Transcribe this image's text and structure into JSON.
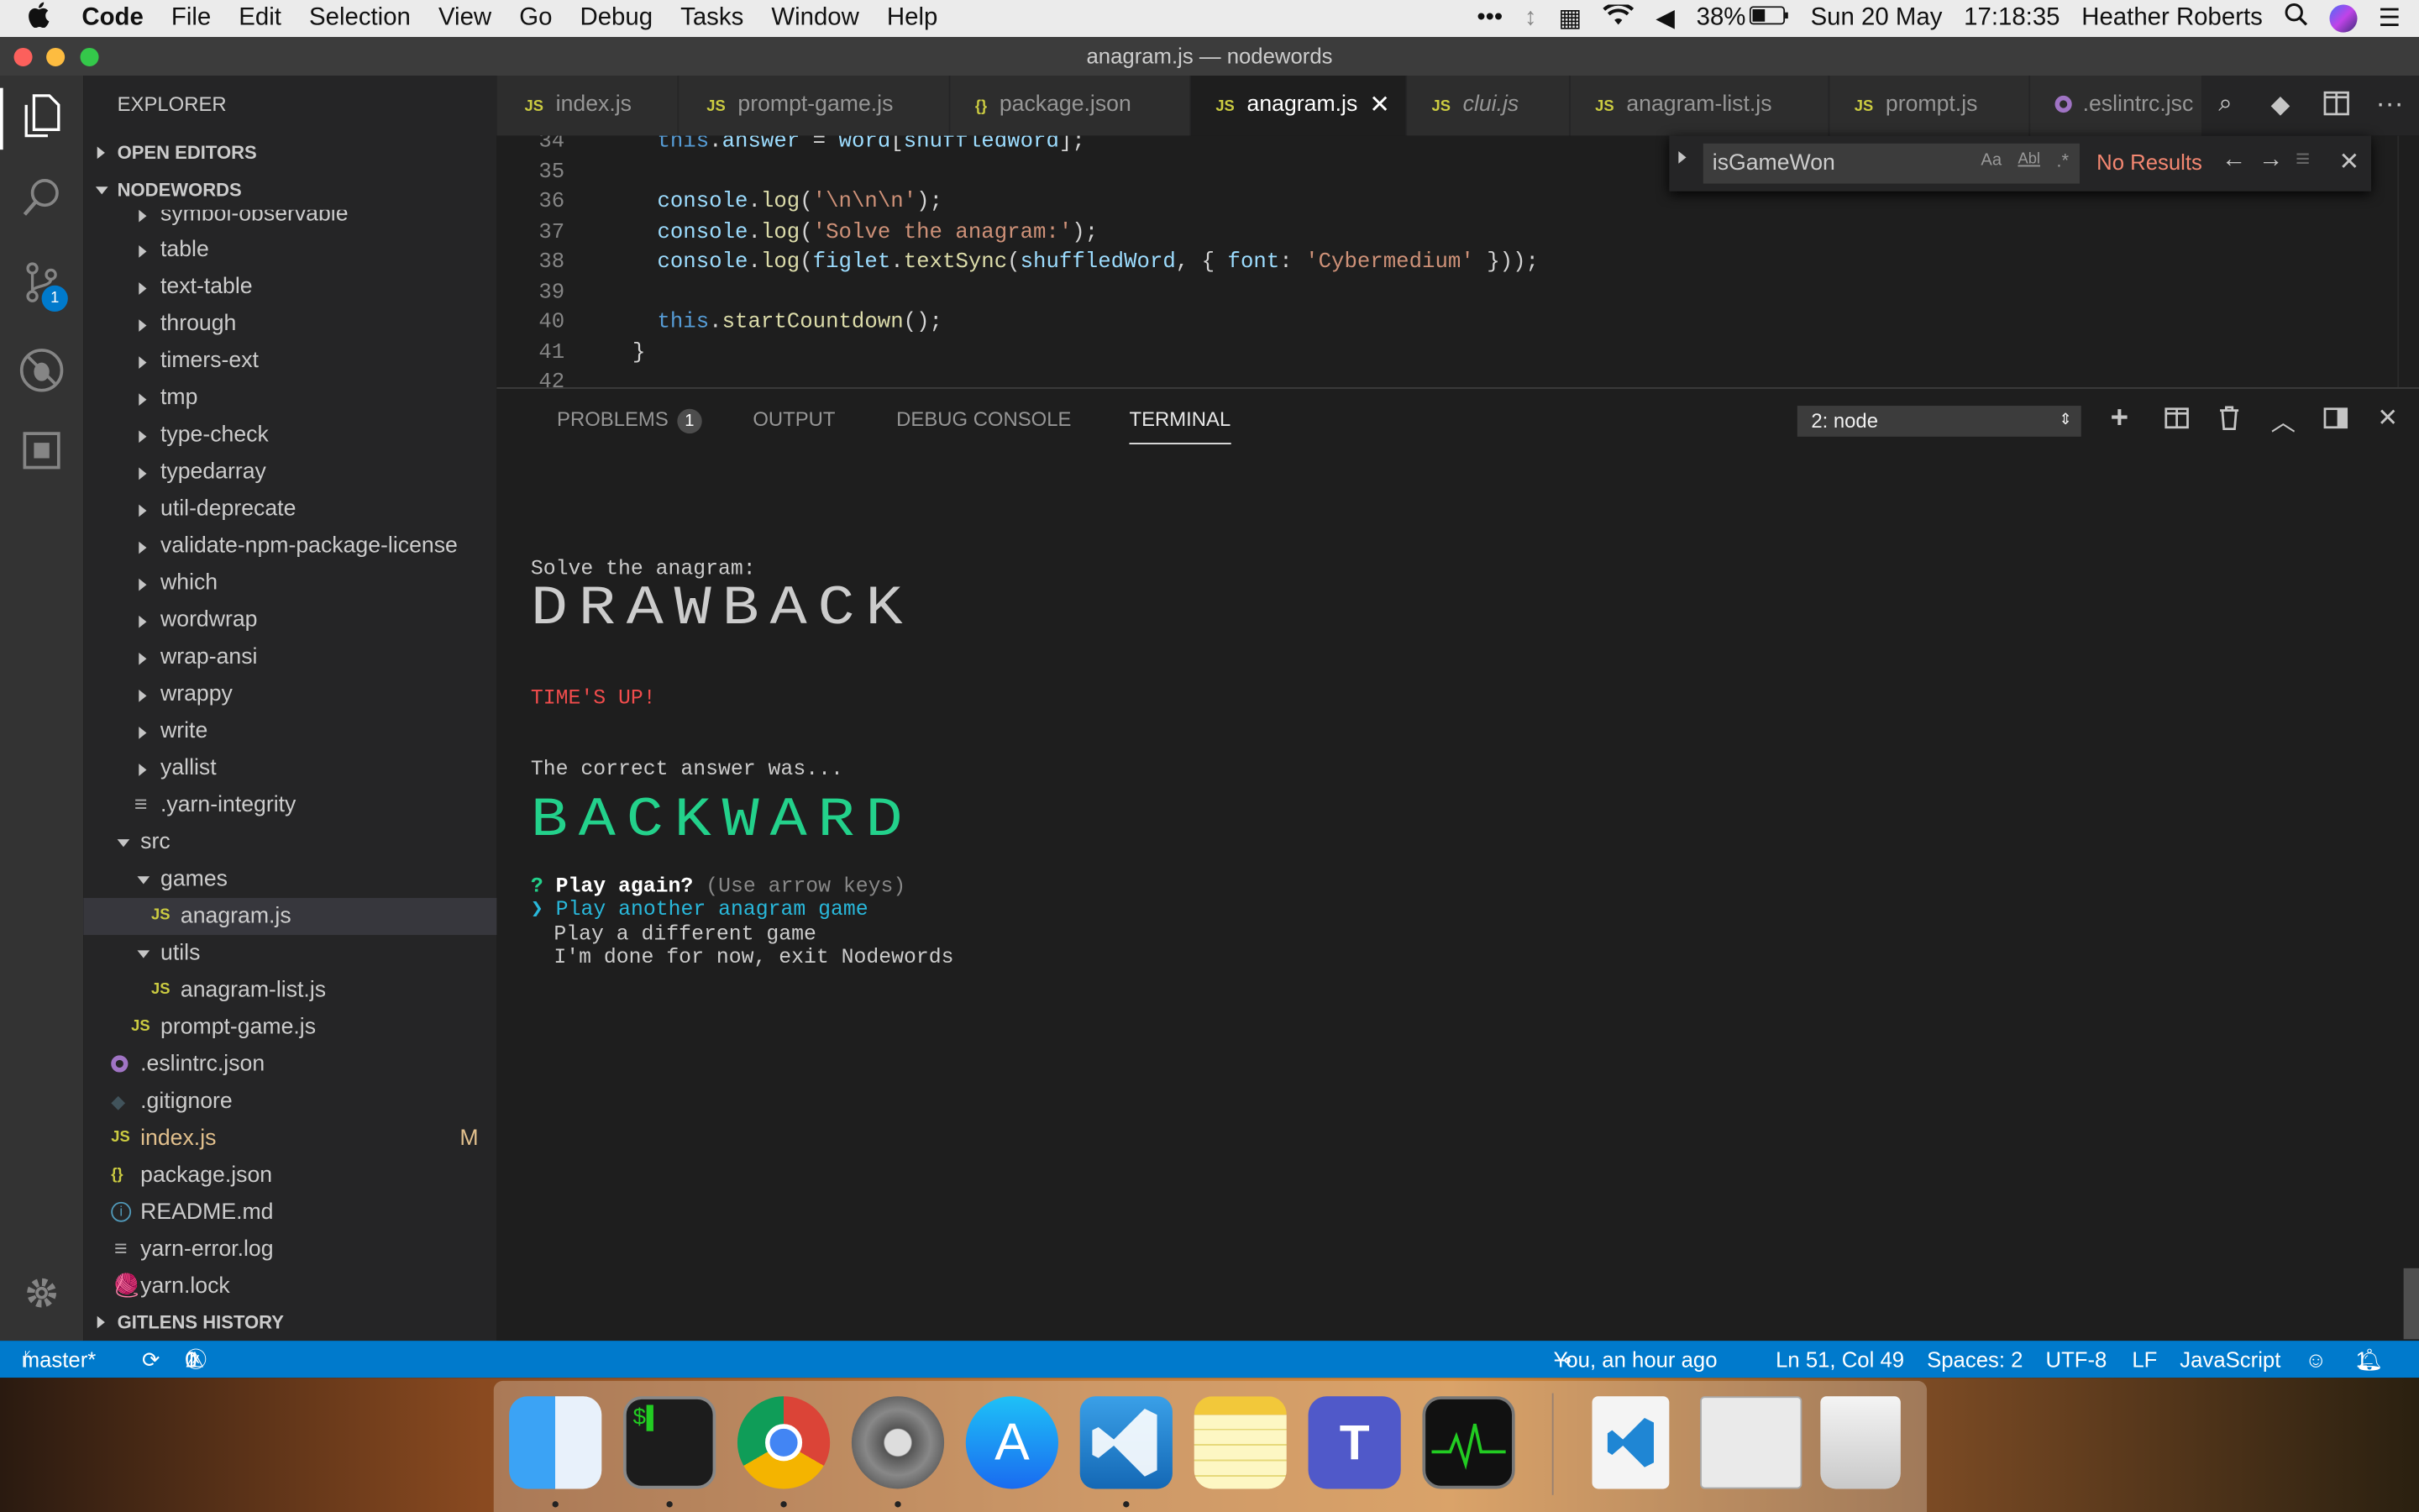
{
  "menubar": {
    "apple": "",
    "app": "Code",
    "items": [
      "File",
      "Edit",
      "Selection",
      "View",
      "Go",
      "Debug",
      "Tasks",
      "Window",
      "Help"
    ],
    "battery": "38%",
    "date": "Sun 20 May",
    "time": "17:18:35",
    "user": "Heather Roberts"
  },
  "window": {
    "title": "anagram.js — nodewords"
  },
  "activity": {
    "scm_badge": "1"
  },
  "sidebar": {
    "header": "EXPLORER",
    "open_editors": "OPEN EDITORS",
    "project": "NODEWORDS",
    "gitlens": "GITLENS HISTORY",
    "items": [
      {
        "label": "symbol-observable"
      },
      {
        "label": "table"
      },
      {
        "label": "text-table"
      },
      {
        "label": "through"
      },
      {
        "label": "timers-ext"
      },
      {
        "label": "tmp"
      },
      {
        "label": "type-check"
      },
      {
        "label": "typedarray"
      },
      {
        "label": "util-deprecate"
      },
      {
        "label": "validate-npm-package-license"
      },
      {
        "label": "which"
      },
      {
        "label": "wordwrap"
      },
      {
        "label": "wrap-ansi"
      },
      {
        "label": "wrappy"
      },
      {
        "label": "write"
      },
      {
        "label": "yallist"
      },
      {
        "label": ".yarn-integrity"
      },
      {
        "label": "src"
      },
      {
        "label": "games"
      },
      {
        "label": "anagram.js"
      },
      {
        "label": "utils"
      },
      {
        "label": "anagram-list.js"
      },
      {
        "label": "prompt-game.js"
      },
      {
        "label": ".eslintrc.json"
      },
      {
        "label": ".gitignore"
      },
      {
        "label": "index.js",
        "badge": "M"
      },
      {
        "label": "package.json"
      },
      {
        "label": "README.md"
      },
      {
        "label": "yarn-error.log"
      },
      {
        "label": "yarn.lock"
      }
    ],
    "js_icon": "JS",
    "json_icon": "{}"
  },
  "tabs": [
    "index.js",
    "prompt-game.js",
    "package.json",
    "anagram.js",
    "clui.js",
    "anagram-list.js",
    "prompt.js",
    ".eslintrc.jsc"
  ],
  "editor": {
    "line_numbers": [
      "34",
      "35",
      "36",
      "37",
      "38",
      "39",
      "40",
      "41",
      "42"
    ]
  },
  "find": {
    "value": "isGameWon",
    "opt_case": "Aa",
    "opt_word": "Abl",
    "opt_regex": ".*",
    "result": "No Results"
  },
  "panel": {
    "problems": "PROBLEMS",
    "problems_count": "1",
    "output": "OUTPUT",
    "debug": "DEBUG CONSOLE",
    "terminal": "TERMINAL",
    "terminal_select": "2: node"
  },
  "terminal": {
    "line1": "Solve the anagram:",
    "big1": "DRAWBACK",
    "timeup": "TIME'S UP!",
    "line2": "The correct answer was...",
    "big2": "BACKWARD",
    "q_mark": "?",
    "question": "Play again?",
    "hint": "(Use arrow keys)",
    "pointer": "❯",
    "opt1": "Play another anagram game",
    "opt2": "Play a different game",
    "opt3": "I'm done for now, exit Nodewords"
  },
  "status": {
    "branch": "master*",
    "errors": "0",
    "warnings": "1",
    "blame": "You, an hour ago",
    "position": "Ln 51, Col 49",
    "spaces": "Spaces: 2",
    "encoding": "UTF-8",
    "eol": "LF",
    "language": "JavaScript",
    "notifications": "1"
  },
  "colors": {
    "accent": "#007acc",
    "error": "#f14c4c",
    "green": "#23d18b",
    "find_no_results": "#f48771"
  }
}
